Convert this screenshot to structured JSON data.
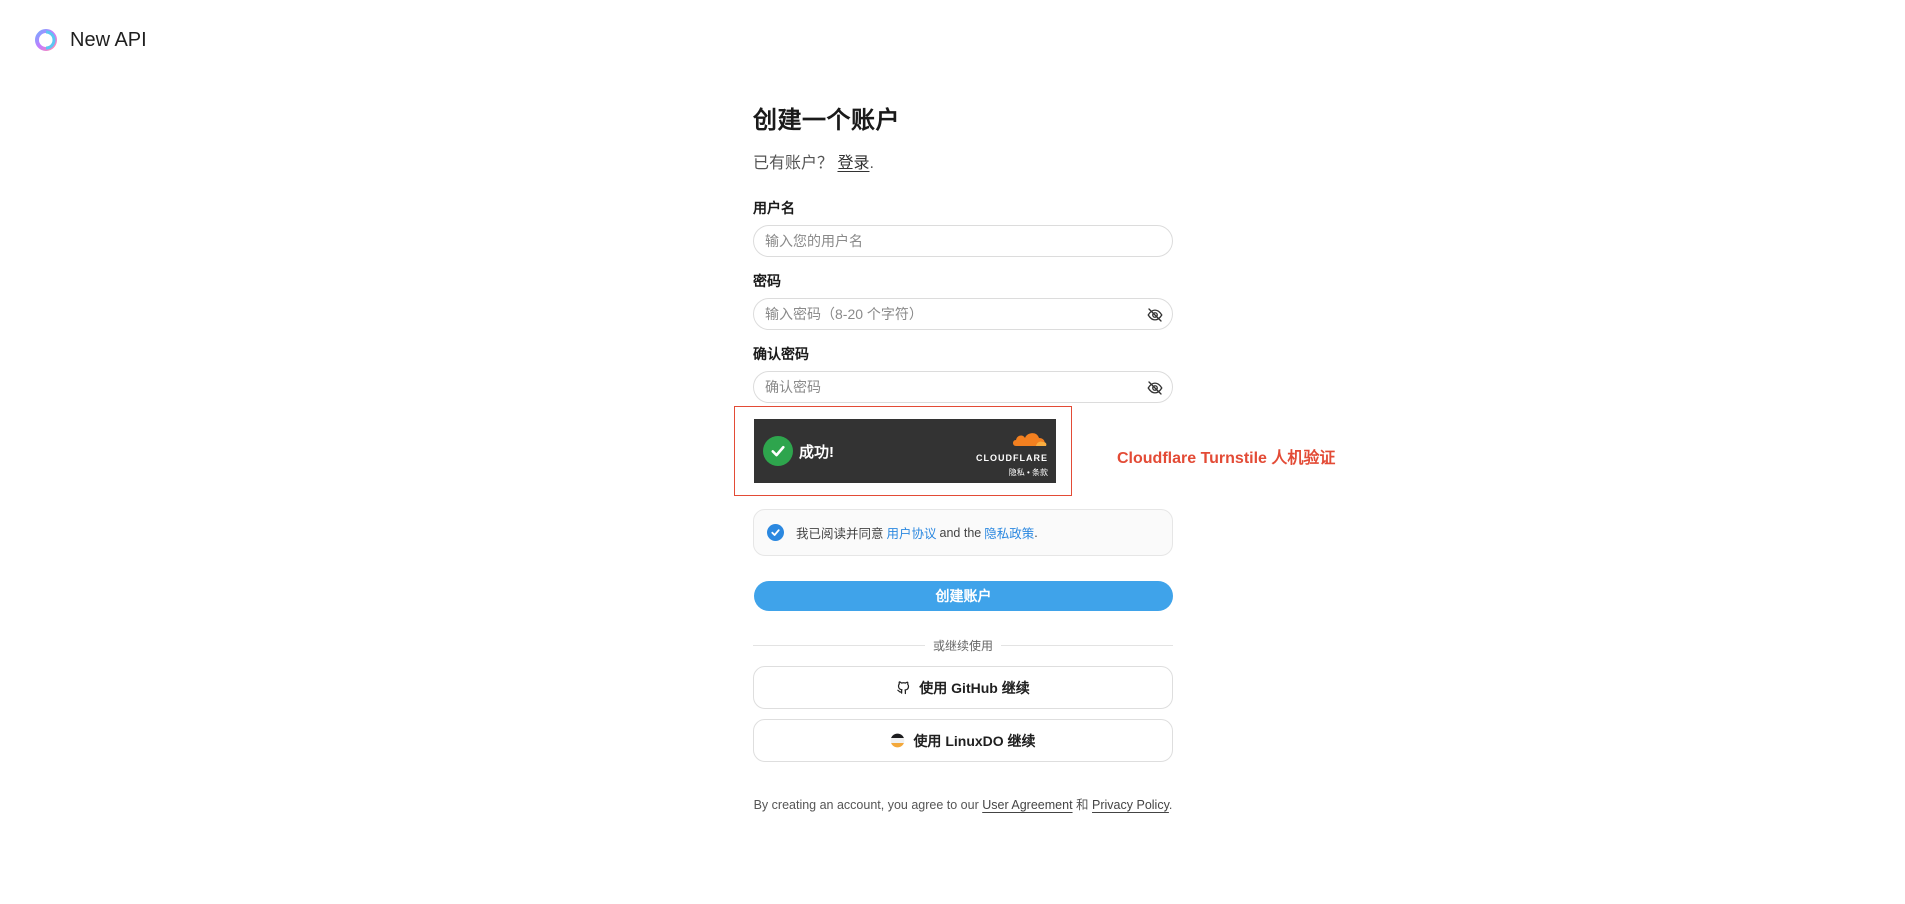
{
  "brand": {
    "name": "New API",
    "logo_icon": "new-api-logo"
  },
  "form": {
    "title": "创建一个账户",
    "subtitle_prefix": "已有账户？",
    "login_link": "登录",
    "subtitle_suffix": ".",
    "username": {
      "label": "用户名",
      "placeholder": "输入您的用户名",
      "value": ""
    },
    "password": {
      "label": "密码",
      "placeholder": "输入密码（8-20 个字符）",
      "value": ""
    },
    "confirm_password": {
      "label": "确认密码",
      "placeholder": "确认密码",
      "value": ""
    }
  },
  "turnstile": {
    "status_text": "成功!",
    "brand_name": "CLOUDFLARE",
    "privacy_link": "隐私",
    "separator": "•",
    "terms_link": "条款",
    "annotation_label": "Cloudflare Turnstile 人机验证",
    "annotation_color": "#e34b36"
  },
  "agreement": {
    "checked": true,
    "text_prefix": "我已阅读并同意",
    "user_agreement": "用户协议",
    "and_text": "and the",
    "privacy_policy": "隐私政策",
    "suffix": "."
  },
  "primary_button": {
    "label": "创建账户",
    "color": "#3fa3ea"
  },
  "divider_text": "或继续使用",
  "oauth": {
    "github": {
      "label": "使用 GitHub 继续",
      "icon": "github-icon"
    },
    "linuxdo": {
      "label": "使用 LinuxDO 继续",
      "icon": "linuxdo-icon"
    }
  },
  "terms": {
    "prefix": "By creating an account, you agree to our",
    "user_agreement": "User Agreement",
    "and": "和",
    "privacy_policy": "Privacy Policy",
    "suffix": "."
  }
}
